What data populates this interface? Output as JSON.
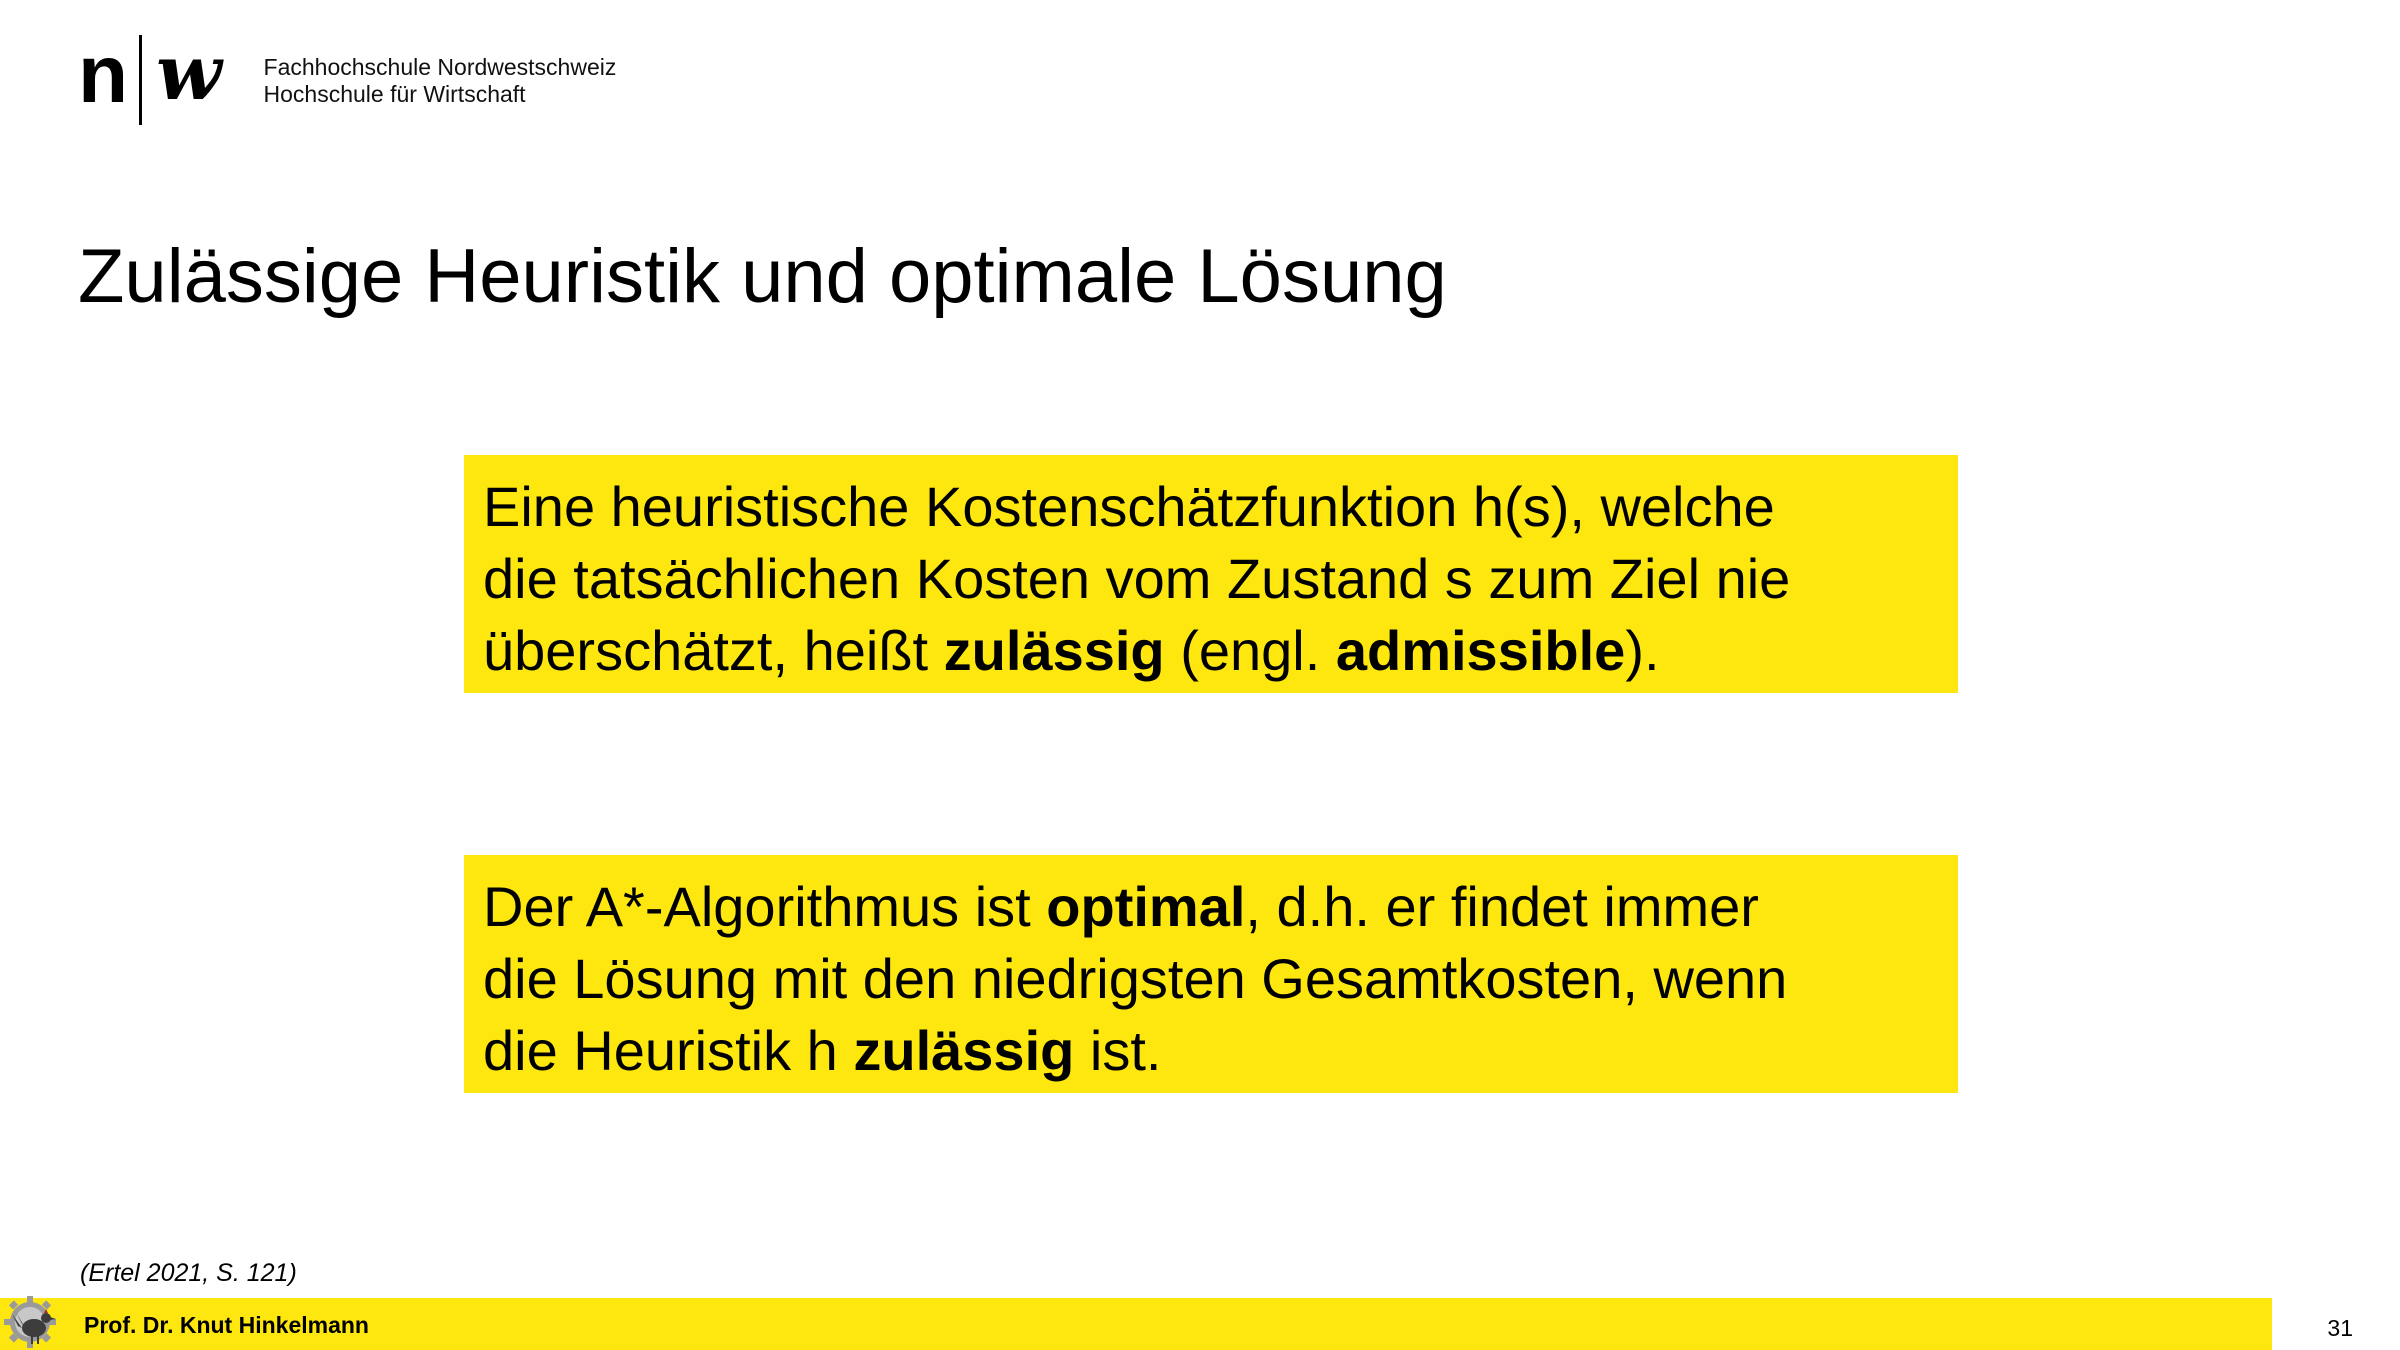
{
  "header": {
    "logo": {
      "letter_n": "n",
      "letter_w": "w",
      "institution_line1": "Fachhochschule Nordwestschweiz",
      "institution_line2": "Hochschule für Wirtschaft"
    }
  },
  "slide": {
    "title": "Zulässige Heuristik und optimale Lösung",
    "box1": {
      "line1": "Eine heuristische Kostenschätzfunktion h(s), welche",
      "line2": "die tatsächlichen Kosten vom Zustand s zum Ziel nie",
      "line3_a": "überschätzt, heißt ",
      "line3_b_bold": "zulässig",
      "line3_c": " (engl. ",
      "line3_d_bold": "admissible",
      "line3_e": ")."
    },
    "box2": {
      "line1_a": "Der A*-Algorithmus ist ",
      "line1_b_bold": "optimal",
      "line1_c": ", d.h. er findet immer",
      "line2": "die Lösung mit den niedrigsten Gesamtkosten, wenn",
      "line3_a": "die Heuristik h ",
      "line3_b_bold": "zulässig",
      "line3_c": " ist."
    },
    "citation": "(Ertel 2021, S. 121)"
  },
  "footer": {
    "author": "Prof. Dr. Knut Hinkelmann",
    "page_number": "31",
    "icon": "rooster-gear-icon",
    "accent_color": "#fde70e"
  }
}
